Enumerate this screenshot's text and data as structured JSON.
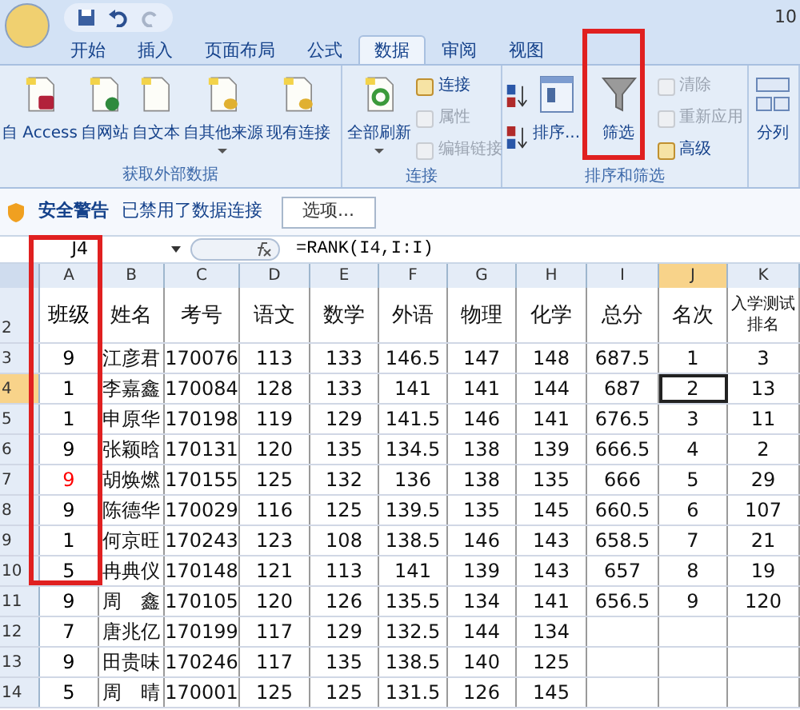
{
  "title_bar": {
    "title": "10"
  },
  "ribbon_tabs": [
    {
      "label": "开始",
      "selected": false
    },
    {
      "label": "插入",
      "selected": false
    },
    {
      "label": "页面布局",
      "selected": false
    },
    {
      "label": "公式",
      "selected": false
    },
    {
      "label": "数据",
      "selected": true
    },
    {
      "label": "审阅",
      "selected": false
    },
    {
      "label": "视图",
      "selected": false
    }
  ],
  "ribbon_groups": [
    {
      "label": "获取外部数据",
      "items": [
        {
          "kind": "large",
          "label": "自 Access",
          "dropdown": false
        },
        {
          "kind": "large",
          "label": "自网站",
          "dropdown": false
        },
        {
          "kind": "large",
          "label": "自文本",
          "dropdown": false
        },
        {
          "kind": "large",
          "label": "自其他来源",
          "dropdown": true
        },
        {
          "kind": "large",
          "label": "现有连接",
          "dropdown": false
        }
      ]
    },
    {
      "label": "连接",
      "items": [
        {
          "kind": "large",
          "label": "全部刷新",
          "dropdown": true
        },
        {
          "kind": "stack",
          "items": [
            {
              "label": "连接",
              "disabled": false
            },
            {
              "label": "属性",
              "disabled": true
            },
            {
              "label": "编辑链接",
              "disabled": true
            }
          ]
        }
      ]
    },
    {
      "label": "排序和筛选",
      "items": [
        {
          "kind": "sortpair"
        },
        {
          "kind": "large",
          "label": "排序...",
          "dropdown": false
        },
        {
          "kind": "large",
          "label": "筛选",
          "dropdown": false
        },
        {
          "kind": "stack",
          "items": [
            {
              "label": "清除",
              "disabled": true
            },
            {
              "label": "重新应用",
              "disabled": true
            },
            {
              "label": "高级",
              "disabled": false
            }
          ]
        }
      ]
    },
    {
      "items": [
        {
          "kind": "large",
          "label": "分列",
          "dropdown": false
        }
      ]
    }
  ],
  "security_bar": {
    "title": "安全警告",
    "message": "已禁用了数据连接",
    "button": "选项..."
  },
  "formula_bar": {
    "name_box": "J4",
    "formula": "=RANK(I4,I:I)"
  },
  "sheet": {
    "columns": [
      {
        "label": "A",
        "selected": false
      },
      {
        "label": "B",
        "selected": false
      },
      {
        "label": "C",
        "selected": false
      },
      {
        "label": "D",
        "selected": false
      },
      {
        "label": "E",
        "selected": false
      },
      {
        "label": "F",
        "selected": false
      },
      {
        "label": "G",
        "selected": false
      },
      {
        "label": "H",
        "selected": false
      },
      {
        "label": "I",
        "selected": false
      },
      {
        "label": "J",
        "selected": true
      },
      {
        "label": "K",
        "selected": false
      }
    ],
    "rows": [
      {
        "number": "2",
        "selected": false,
        "color": "#000000",
        "cells": [
          "班级",
          "姓名",
          "考号",
          "语文",
          "数学",
          "外语",
          "物理",
          "化学",
          "总分",
          "名次",
          "入学测试排名"
        ]
      },
      {
        "number": "3",
        "selected": false,
        "color": "#000000",
        "cells": [
          "9",
          "江彦君",
          "170076",
          "113",
          "133",
          "146.5",
          "147",
          "148",
          "687.5",
          "1",
          "3"
        ]
      },
      {
        "number": "4",
        "selected": true,
        "color": "#000000",
        "cells": [
          "1",
          "李嘉鑫",
          "170084",
          "128",
          "133",
          "141",
          "141",
          "144",
          "687",
          "2",
          "13"
        ]
      },
      {
        "number": "5",
        "selected": false,
        "color": "#000000",
        "cells": [
          "1",
          "申原华",
          "170198",
          "119",
          "129",
          "141.5",
          "146",
          "141",
          "676.5",
          "3",
          "11"
        ]
      },
      {
        "number": "6",
        "selected": false,
        "color": "#000000",
        "cells": [
          "9",
          "张颖晗",
          "170131",
          "120",
          "135",
          "134.5",
          "138",
          "139",
          "666.5",
          "4",
          "2"
        ]
      },
      {
        "number": "7",
        "selected": false,
        "color": "#ff0000",
        "cells": [
          "9",
          "胡焕燃",
          "170155",
          "125",
          "132",
          "136",
          "138",
          "135",
          "666",
          "5",
          "29"
        ]
      },
      {
        "number": "8",
        "selected": false,
        "color": "#000000",
        "cells": [
          "9",
          "陈德华",
          "170029",
          "116",
          "125",
          "139.5",
          "135",
          "145",
          "660.5",
          "6",
          "107"
        ]
      },
      {
        "number": "9",
        "selected": false,
        "color": "#000000",
        "cells": [
          "1",
          "何京旺",
          "170243",
          "123",
          "108",
          "138.5",
          "146",
          "143",
          "658.5",
          "7",
          "21"
        ]
      },
      {
        "number": "10",
        "selected": false,
        "color": "#000000",
        "cells": [
          "5",
          "冉典仪",
          "170148",
          "121",
          "113",
          "141",
          "139",
          "143",
          "657",
          "8",
          "19"
        ]
      },
      {
        "number": "11",
        "selected": false,
        "color": "#000000",
        "cells": [
          "9",
          "周　鑫",
          "170105",
          "120",
          "126",
          "135.5",
          "134",
          "141",
          "656.5",
          "9",
          "120"
        ]
      },
      {
        "number": "12",
        "selected": false,
        "color": "#000000",
        "cells": [
          "7",
          "唐兆亿",
          "170199",
          "117",
          "129",
          "132.5",
          "144",
          "134",
          "",
          "",
          ""
        ]
      },
      {
        "number": "13",
        "selected": false,
        "color": "#000000",
        "cells": [
          "9",
          "田贵味",
          "170246",
          "117",
          "135",
          "138.5",
          "140",
          "125",
          "",
          "",
          ""
        ]
      },
      {
        "number": "14",
        "selected": false,
        "color": "#000000",
        "cells": [
          "5",
          "周　晴",
          "170001",
          "125",
          "125",
          "131.5",
          "126",
          "145",
          "",
          "",
          ""
        ]
      }
    ]
  }
}
